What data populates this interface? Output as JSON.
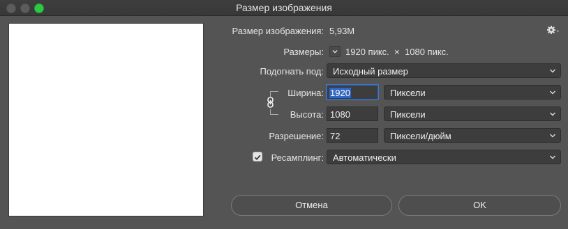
{
  "window": {
    "title": "Размер изображения"
  },
  "image_size": {
    "label": "Размер изображения:",
    "value": "5,93M"
  },
  "dimensions": {
    "label": "Размеры:",
    "width_value": "1920 пикс.",
    "separator": "×",
    "height_value": "1080 пикс."
  },
  "fit_to": {
    "label": "Подогнать под:",
    "selected": "Исходный размер"
  },
  "width": {
    "label": "Ширина:",
    "value": "1920",
    "unit": "Пиксели"
  },
  "height": {
    "label": "Высота:",
    "value": "1080",
    "unit": "Пиксели"
  },
  "resolution": {
    "label": "Разрешение:",
    "value": "72",
    "unit": "Пиксели/дюйм"
  },
  "resample": {
    "label": "Ресамплинг:",
    "checked": true,
    "selected": "Автоматически"
  },
  "buttons": {
    "cancel": "Отмена",
    "ok": "OK"
  },
  "icons": {
    "settings": "gear-icon",
    "constrain": "chain-link-icon",
    "dropdown": "chevron-down-icon",
    "check": "checkmark-icon"
  },
  "colors": {
    "dialog_bg": "#545454",
    "field_bg": "#3d3d3d",
    "focus_highlight": "#2f67c2",
    "zoom_button": "#2ec845"
  }
}
